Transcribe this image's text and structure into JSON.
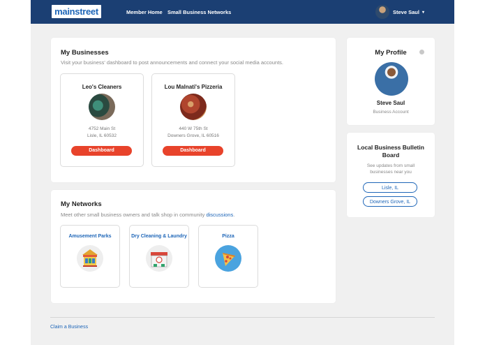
{
  "header": {
    "logo_text": "mainstreet",
    "nav": [
      {
        "label": "Member Home"
      },
      {
        "label": "Small Business Networks"
      }
    ],
    "user_name": "Steve Saul",
    "user_caret": "▾"
  },
  "my_businesses": {
    "title": "My Businesses",
    "subtitle": "Visit your business' dashboard to post announcements and connect your social media accounts.",
    "items": [
      {
        "name": "Leo's Cleaners",
        "address_line1": "4752 Main St",
        "address_line2": "Lisle, IL 60532",
        "button_label": "Dashboard"
      },
      {
        "name": "Lou Malnati's Pizzeria",
        "address_line1": "440 W 75th St",
        "address_line2": "Downers Grove, IL 60516",
        "button_label": "Dashboard"
      }
    ]
  },
  "my_networks": {
    "title": "My Networks",
    "subtitle_prefix": "Meet other small business owners and talk shop in community ",
    "subtitle_link": "discussions",
    "subtitle_suffix": ".",
    "items": [
      {
        "name": "Amusement Parks",
        "icon": "carousel-icon"
      },
      {
        "name": "Dry Cleaning & Laundry",
        "icon": "laundry-shop-icon"
      },
      {
        "name": "Pizza",
        "icon": "pizza-icon"
      }
    ]
  },
  "profile": {
    "title": "My Profile",
    "name": "Steve Saul",
    "role": "Business Account",
    "settings_icon": "gear-icon"
  },
  "bulletin": {
    "title": "Local Business Bulletin Board",
    "subtitle": "See updates from small businesses near you",
    "locations": [
      {
        "label": "Lisle, IL"
      },
      {
        "label": "Downers Grove, IL"
      }
    ]
  },
  "footer": {
    "link_label": "Claim a Business"
  },
  "colors": {
    "header_bg": "#1b3f73",
    "accent": "#1e66b8",
    "button_red": "#e8432b",
    "page_bg": "#f0f0f0"
  }
}
